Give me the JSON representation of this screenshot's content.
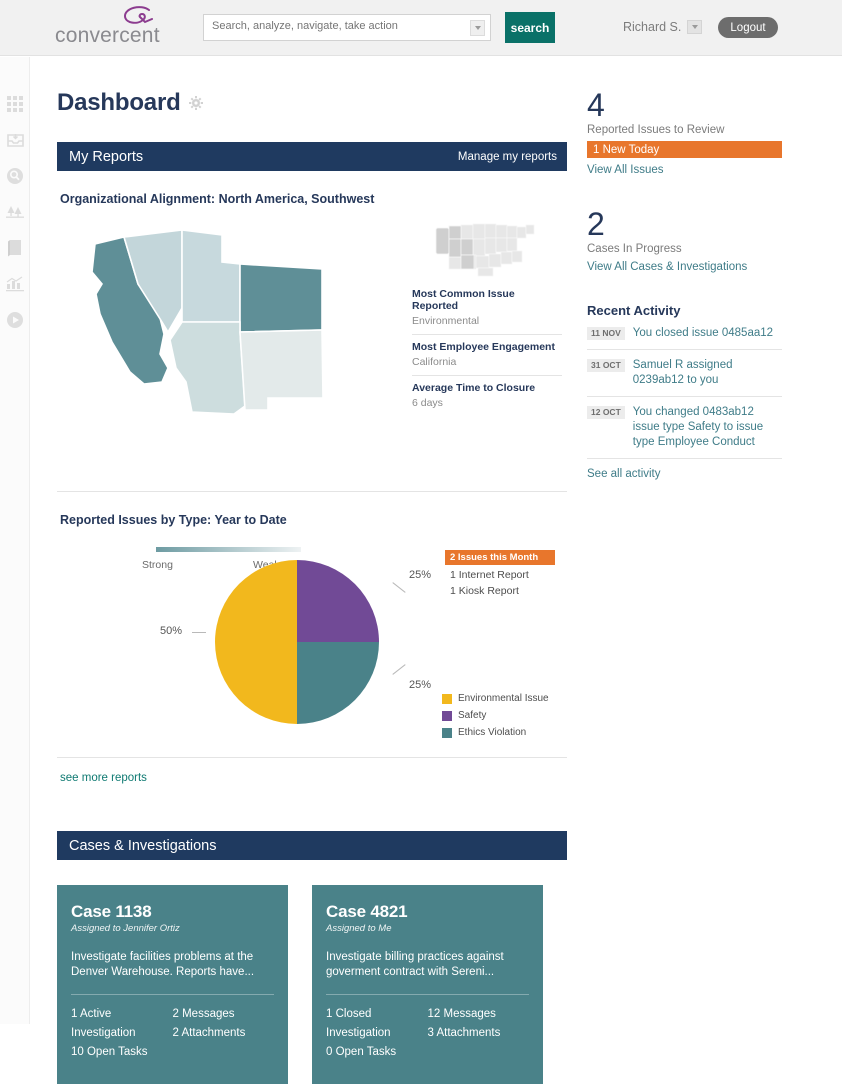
{
  "header": {
    "logo_text": "convercent",
    "logo_icon": "convercent-swoosh-logo",
    "search_placeholder": "Search, analyze, navigate, take action",
    "search_value": "",
    "search_button": "search",
    "user_name": "Richard S.",
    "logout_label": "Logout"
  },
  "rail": {
    "items": [
      {
        "icon": "grid-apps-icon"
      },
      {
        "icon": "inbox-download-icon"
      },
      {
        "icon": "magnifier-search-icon"
      },
      {
        "icon": "trees-nature-icon"
      },
      {
        "icon": "book-icon"
      },
      {
        "icon": "bar-chart-icon"
      },
      {
        "icon": "play-circle-icon"
      }
    ]
  },
  "main": {
    "page_title": "Dashboard",
    "settings_icon": "gear-icon",
    "reports_panel": {
      "title": "My Reports",
      "manage_link": "Manage my reports"
    },
    "map_report": {
      "title": "Organizational Alignment: North America, Southwest",
      "thumb_icon": "us-map-thumbnail",
      "stats": [
        {
          "label": "Most Common Issue Reported",
          "value": "Environmental"
        },
        {
          "label": "Most Employee Engagement",
          "value": "California"
        },
        {
          "label": "Average Time to Closure",
          "value": "6 days"
        }
      ],
      "legend_strong": "Strong",
      "legend_weak": "Weak"
    },
    "pie_report": {
      "title": "Reported Issues by Type: Year to Date",
      "month_badge": "2 Issues this Month",
      "month_breakdown": [
        "1 Internet Report",
        "1 Kiosk Report"
      ]
    },
    "see_more_link": "see more reports",
    "cases_panel": {
      "title": "Cases & Investigations",
      "cards": [
        {
          "title": "Case 1138",
          "assigned": "Assigned to Jennifer Ortiz",
          "description": "Investigate facilities problems at the Denver Warehouse. Reports have...",
          "left_stats": [
            "1 Active Investigation",
            "10 Open Tasks"
          ],
          "right_stats": [
            "2 Messages",
            "2 Attachments"
          ]
        },
        {
          "title": "Case 4821",
          "assigned": "Assigned to Me",
          "description": "Investigate billing practices against goverment contract with Sereni...",
          "left_stats": [
            "1 Closed Investigation",
            "0 Open Tasks"
          ],
          "right_stats": [
            "12 Messages",
            "3 Attachments"
          ]
        }
      ]
    }
  },
  "sidebar": {
    "issues_count": "4",
    "issues_label": "Reported Issues to Review",
    "new_today": "1 New Today",
    "view_all_issues": "View All Issues",
    "cases_count": "2",
    "cases_label": "Cases In Progress",
    "view_all_cases": "View All Cases & Investigations",
    "recent_activity_title": "Recent Activity",
    "activity": [
      {
        "date": "11 NOV",
        "text": "You closed issue 0485aa12"
      },
      {
        "date": "31 OCT",
        "text": "Samuel R assigned 0239ab12 to you"
      },
      {
        "date": "12 OCT",
        "text": "You changed 0483ab12 issue type Safety to issue type Employee Conduct"
      }
    ],
    "see_all_activity": "See all activity"
  },
  "chart_data": [
    {
      "type": "heatmap",
      "title": "Organizational Alignment: North America, Southwest",
      "subtype": "choropleth-map",
      "legend": {
        "low": "Strong",
        "high": "Weak",
        "position": "below"
      },
      "regions": [
        {
          "name": "California",
          "strength": "Strong",
          "color": "#5f8f97"
        },
        {
          "name": "Nevada",
          "strength": "Weak",
          "color": "#c3d6da"
        },
        {
          "name": "Utah",
          "strength": "Weak",
          "color": "#c7d9dd"
        },
        {
          "name": "Colorado",
          "strength": "Strong",
          "color": "#5f8f97"
        },
        {
          "name": "Arizona",
          "strength": "Weak",
          "color": "#cdddde"
        },
        {
          "name": "New Mexico",
          "strength": "Weak",
          "color": "#e3eaea"
        }
      ]
    },
    {
      "type": "pie",
      "title": "Reported Issues by Type: Year to Date",
      "categories": [
        "Environmental Issue",
        "Safety",
        "Ethics Violation"
      ],
      "values": [
        50,
        25,
        25
      ],
      "labels": [
        "50%",
        "25%",
        "25%"
      ],
      "colors": [
        "#f2b81d",
        "#714a96",
        "#4a8289"
      ],
      "legend_position": "right"
    }
  ],
  "colors": {
    "navy": "#1f3a60",
    "teal": "#0a7168",
    "orange": "#e8762c",
    "case_teal": "#4a8289",
    "link_teal": "#3f7c88"
  }
}
